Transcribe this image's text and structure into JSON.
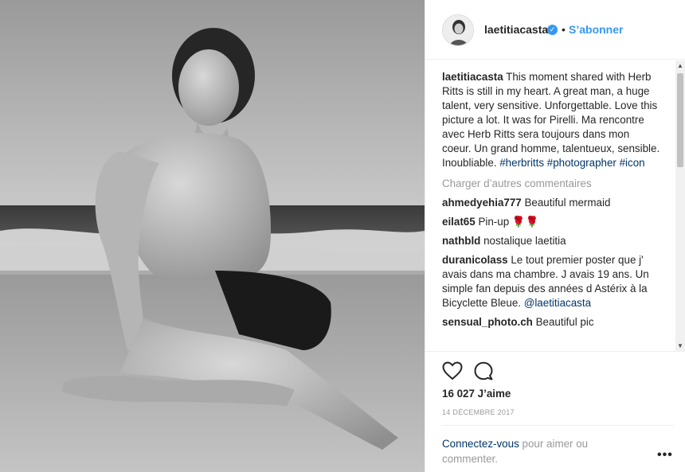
{
  "post": {
    "username": "laetitiacasta",
    "follow_label": "S’abonner",
    "dot": "•",
    "verified_glyph": "✓"
  },
  "caption": {
    "username": "laetitiacasta",
    "text": "This moment shared with Herb Ritts is still in my heart. A great man, a huge talent, very sensitive. Unforgettable. Love this picture a lot. It was for Pirelli. Ma rencontre avec Herb Ritts sera toujours dans mon coeur. Un grand homme, talentueux, sensible. Inoubliable.",
    "hashtags": "#herbritts #photographer #icon"
  },
  "load_more": "Charger d’autres commentaires",
  "comments": [
    {
      "user": "ahmedyehia777",
      "text": "Beautiful mermaid"
    },
    {
      "user": "eilat65",
      "text": "Pin-up 🌹🌹"
    },
    {
      "user": "nathbld",
      "text": "nostalique laetitia"
    },
    {
      "user": "duranicolass",
      "text": "Le tout premier poster que j' avais dans ma chambre. J avais 19 ans. Un simple fan depuis des années d Astérix à la Bicyclette Bleue.",
      "mention": "@laetitiacasta"
    },
    {
      "user": "sensual_photo.ch",
      "text": "Beautiful pic"
    }
  ],
  "likes": "16 027 J’aime",
  "date": "14 DÉCEMBRE 2017",
  "login": {
    "link": "Connectez-vous",
    "rest": "pour aimer ou commenter."
  },
  "more_glyph": "•••",
  "scroll": {
    "up": "▲",
    "down": "▼"
  },
  "icons": [
    "heart-icon",
    "comment-icon",
    "verified-icon",
    "more-options-icon"
  ],
  "colors": {
    "link_blue": "#3897f0",
    "dark_link": "#003569",
    "muted": "#999999",
    "border": "#efefef"
  }
}
